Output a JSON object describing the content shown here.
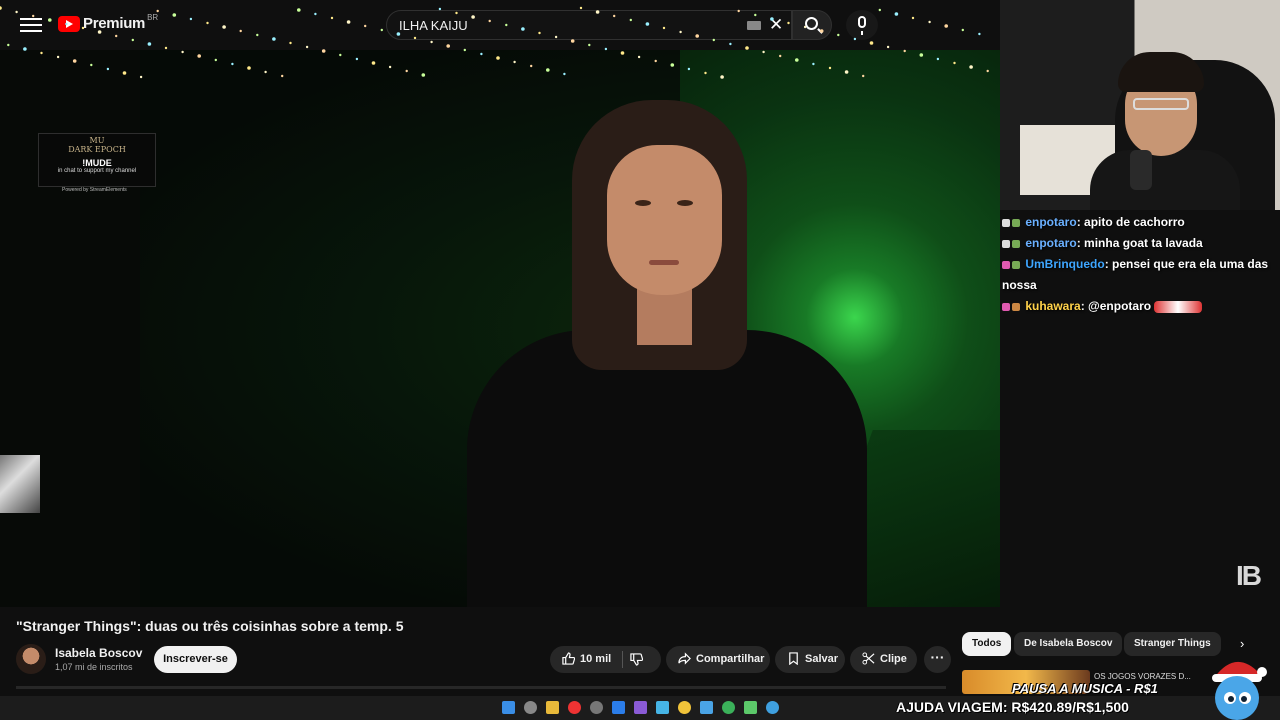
{
  "header": {
    "logo_text": "Premium",
    "logo_region": "BR",
    "search_query": "ILHA KAIJU",
    "icons": [
      "menu-icon",
      "youtube-logo",
      "keyboard-icon",
      "close-icon",
      "search-icon",
      "mic-icon"
    ]
  },
  "overlay_widget": {
    "brand": "MU\nDARK EPOCH",
    "command": "!MUDE",
    "subtitle": "in chat to support my channel",
    "powered": "Powered by StreamElements"
  },
  "watermark": "IB",
  "chat": {
    "messages": [
      {
        "user": "enpotaro",
        "text": "apito de cachorro",
        "user_color": "#6ab0ff"
      },
      {
        "user": "enpotaro",
        "text": "minha goat ta lavada",
        "user_color": "#6ab0ff"
      },
      {
        "user": "UmBrinquedo",
        "text": "pensei que era ela uma das nossa",
        "user_color": "#3ea6ff"
      },
      {
        "user": "kuhawara",
        "text": "@enpotaro",
        "user_color": "#ffd24a"
      }
    ]
  },
  "video": {
    "title": "\"Stranger Things\": duas ou três coisinhas sobre a temp. 5",
    "channel_name": "Isabela Boscov",
    "subscribers": "1,07 mi de inscritos",
    "subscribe_label": "Inscrever-se",
    "like_count": "10 mil",
    "share_label": "Compartilhar",
    "save_label": "Salvar",
    "clip_label": "Clipe",
    "more_label": "···"
  },
  "chips": [
    "Todos",
    "De Isabela Boscov",
    "Stranger Things"
  ],
  "recommendation": {
    "title": "OS JOGOS VORAZES D..."
  },
  "stream_overlay": {
    "pausa": "PAUSA A MUSICA - R$1",
    "ajuda": "AJUDA VIAGEM: R$420.89/R$1,500"
  },
  "colors": {
    "background": "#0f0f0f",
    "brand_red": "#ff0000",
    "pill": "#272727",
    "subscribe_bg": "#f1f1f1"
  }
}
